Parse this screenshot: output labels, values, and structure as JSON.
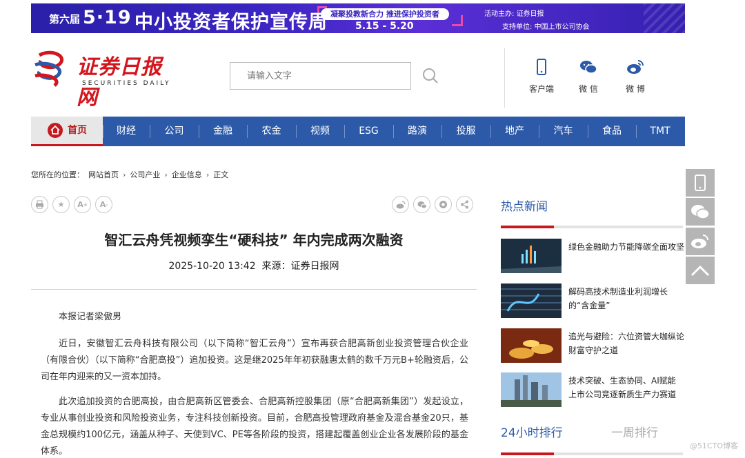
{
  "banner": {
    "edition": "第六届",
    "headline_date": "5·19",
    "headline_text": "中小投资者保护宣传周",
    "slogan": "凝聚投教新合力 推进保护投资者",
    "date_range": "5.15 - 5.20",
    "organizer_label": "活动主办:",
    "supporter_label": "支持单位:",
    "organizer_logo_text": "证券日报",
    "supporter_name": "中国上市公司协会"
  },
  "header": {
    "logo_cn": "证券日报网",
    "logo_en": "SECURITIES DAILY",
    "search_placeholder": "请输入文字",
    "quick_links": [
      {
        "label": "客户端",
        "icon": "mobile-icon"
      },
      {
        "label": "微 信",
        "icon": "wechat-icon"
      },
      {
        "label": "微 博",
        "icon": "weibo-icon"
      }
    ]
  },
  "nav": {
    "home_label": "首页",
    "items": [
      "财经",
      "公司",
      "金融",
      "农金",
      "视频",
      "ESG",
      "路演",
      "投服",
      "地产",
      "汽车",
      "食品",
      "TMT"
    ]
  },
  "breadcrumb": {
    "prefix": "您所在的位置：",
    "items": [
      "网站首页",
      "公司产业",
      "企业信息",
      "正文"
    ]
  },
  "tools_left": [
    "print-icon",
    "favorite-icon",
    "font-larger-icon",
    "font-smaller-icon"
  ],
  "tools_right": [
    "weibo-share-icon",
    "wechat-share-icon",
    "qzone-share-icon",
    "share-icon"
  ],
  "article": {
    "title": "智汇云舟凭视频孪生“硬科技” 年内完成两次融资",
    "datetime": "2025-10-20 13:42",
    "source_label": "来源：",
    "source": "证券日报网",
    "paragraphs": [
      "本报记者梁傲男",
      "近日，安徽智汇云舟科技有限公司（以下简称“智汇云舟”）宣布再获合肥高新创业投资管理合伙企业（有限合伙）（以下简称“合肥高投”）追加投资。这是继2025年年初获融惠太鹤的数千万元B+轮融资后，公司在年内迎来的又一资本加持。",
      "此次追加投资的合肥高投，由合肥高新区管委会、合肥高新控股集团（原“合肥高新集团”）发起设立，专业从事创业投资和风险投资业务，专注科技创新投资。目前，合肥高投管理政府基金及混合基金20只，基金总规模约100亿元，涵盖从种子、天使到VC、PE等各阶段的投资，搭建起覆盖创业企业各发展阶段的基金体系。"
    ]
  },
  "sidebar": {
    "hot_title": "热点新闻",
    "news": [
      {
        "title": "绿色金融助力节能降碳全面攻坚"
      },
      {
        "title": "解码高技术制造业利润增长的“含金量”"
      },
      {
        "title": "追光与避险：六位资管大咖纵论财富守护之道"
      },
      {
        "title": "技术突破、生态协同、AI赋能 上市公司竞逐新质生产力赛道"
      }
    ],
    "rank_tabs": [
      "24小时排行",
      "一周排行"
    ]
  },
  "float_buttons": [
    "mobile-icon",
    "wechat-icon",
    "weibo-icon",
    "back-to-top-icon"
  ],
  "watermark": "@51CTO博客",
  "colors": {
    "nav_blue": "#2d5aa8",
    "brand_red": "#c9171e",
    "banner_purple": "#3b25c2"
  }
}
